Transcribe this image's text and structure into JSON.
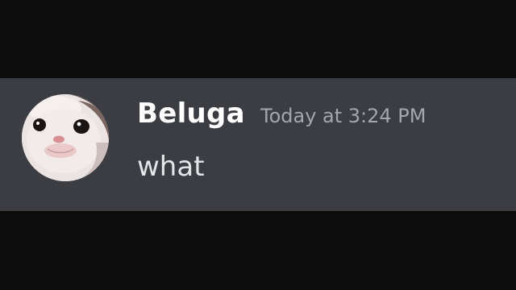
{
  "message": {
    "username": "Beluga",
    "timestamp": "Today at 3:24 PM",
    "content": "what",
    "avatar_icon": "cat-face-avatar"
  },
  "colors": {
    "background": "#0c0c0d",
    "message_background": "#3b3d43",
    "username": "#ffffff",
    "timestamp": "#a3a6ad",
    "content": "#e3e5e8"
  }
}
